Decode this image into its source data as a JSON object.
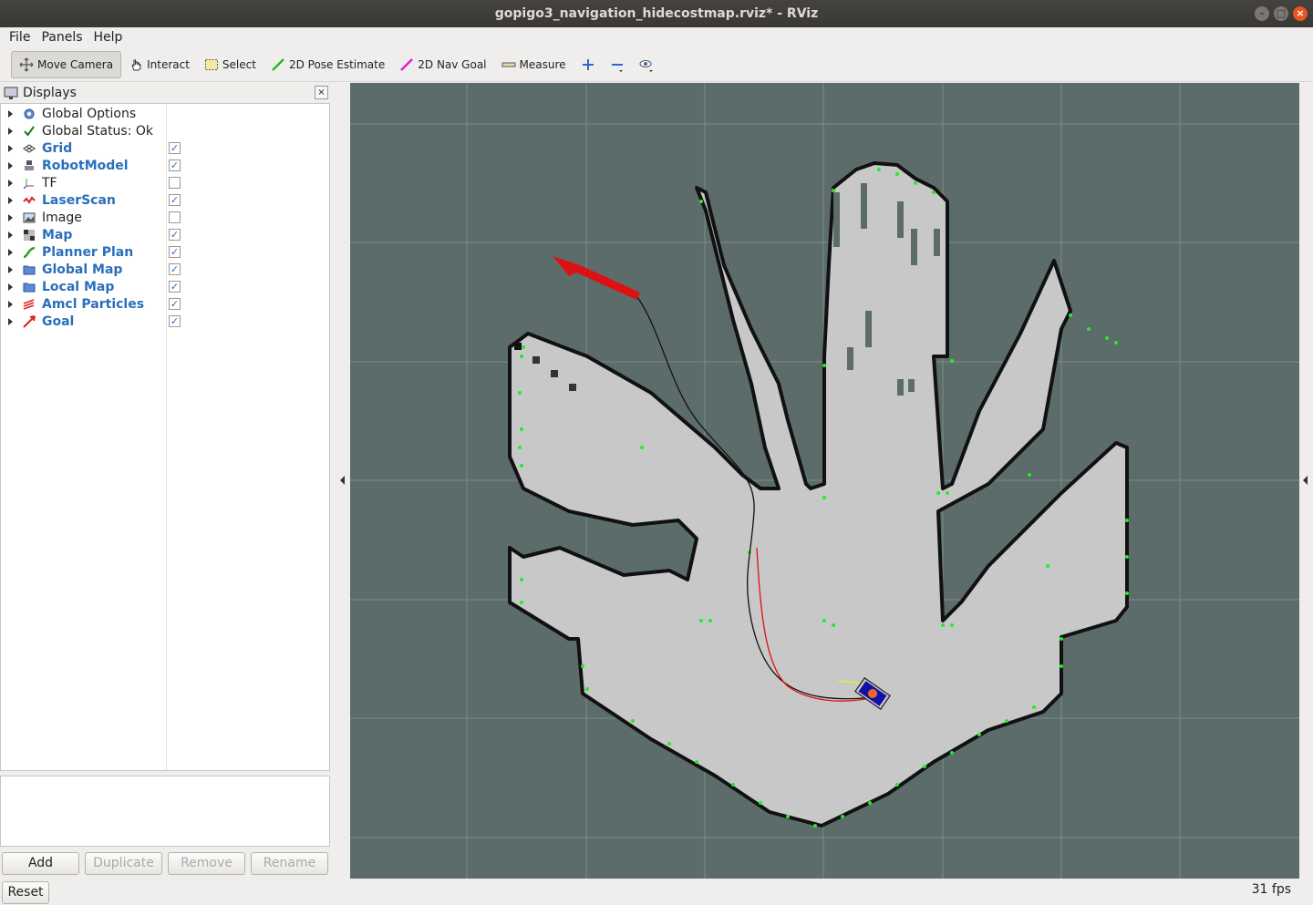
{
  "window": {
    "title": "gopigo3_navigation_hidecostmap.rviz* - RViz"
  },
  "menu": {
    "file": "File",
    "panels": "Panels",
    "help": "Help"
  },
  "toolbar": {
    "move_camera": "Move Camera",
    "interact": "Interact",
    "select": "Select",
    "pose_estimate": "2D Pose Estimate",
    "nav_goal": "2D Nav Goal",
    "measure": "Measure"
  },
  "displays": {
    "title": "Displays",
    "items": [
      {
        "label": "Global Options",
        "icon": "gear-icon",
        "checked": null,
        "highlight": false
      },
      {
        "label": "Global Status: Ok",
        "icon": "check-icon",
        "checked": null,
        "highlight": false
      },
      {
        "label": "Grid",
        "icon": "grid-icon",
        "checked": true,
        "highlight": true
      },
      {
        "label": "RobotModel",
        "icon": "robot-icon",
        "checked": true,
        "highlight": true
      },
      {
        "label": "TF",
        "icon": "axes-icon",
        "checked": false,
        "highlight": false
      },
      {
        "label": "LaserScan",
        "icon": "laser-icon",
        "checked": true,
        "highlight": true
      },
      {
        "label": "Image",
        "icon": "image-icon",
        "checked": false,
        "highlight": false
      },
      {
        "label": "Map",
        "icon": "map-icon",
        "checked": true,
        "highlight": true
      },
      {
        "label": "Planner Plan",
        "icon": "path-icon",
        "checked": true,
        "highlight": true
      },
      {
        "label": "Global Map",
        "icon": "folder-icon",
        "checked": true,
        "highlight": true
      },
      {
        "label": "Local Map",
        "icon": "folder-icon",
        "checked": true,
        "highlight": true
      },
      {
        "label": "Amcl Particles",
        "icon": "particles-icon",
        "checked": true,
        "highlight": true
      },
      {
        "label": "Goal",
        "icon": "goal-icon",
        "checked": true,
        "highlight": true
      }
    ]
  },
  "buttons": {
    "add": "Add",
    "duplicate": "Duplicate",
    "remove": "Remove",
    "rename": "Rename",
    "reset": "Reset"
  },
  "status": {
    "fps": "31 fps"
  },
  "colors": {
    "background": "#5c6c6a",
    "free": "#c8c8c8",
    "occupied": "#111111",
    "laser": "#22ee22",
    "goal_arrow": "#dd1111",
    "highlight": "#2a6ebb"
  }
}
